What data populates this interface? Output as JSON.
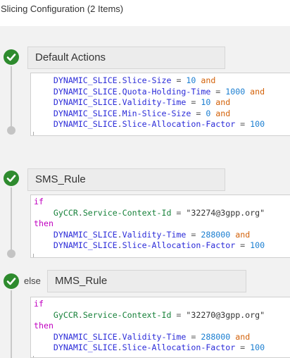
{
  "header": {
    "title": "Slicing Configuration (2 Items)"
  },
  "rules": [
    {
      "name": "Default Actions",
      "prefix": "",
      "lines": [
        [
          {
            "t": "    DYNAMIC_SLICE",
            "c": "obj"
          },
          {
            "t": ".",
            "c": "op"
          },
          {
            "t": "Slice-Size",
            "c": "prop"
          },
          {
            "t": " = ",
            "c": "op"
          },
          {
            "t": "10",
            "c": "num"
          },
          {
            "t": " and",
            "c": "logic"
          }
        ],
        [
          {
            "t": "    DYNAMIC_SLICE",
            "c": "obj"
          },
          {
            "t": ".",
            "c": "op"
          },
          {
            "t": "Quota-Holding-Time",
            "c": "prop"
          },
          {
            "t": " = ",
            "c": "op"
          },
          {
            "t": "1000",
            "c": "num"
          },
          {
            "t": " and",
            "c": "logic"
          }
        ],
        [
          {
            "t": "    DYNAMIC_SLICE",
            "c": "obj"
          },
          {
            "t": ".",
            "c": "op"
          },
          {
            "t": "Validity-Time",
            "c": "prop"
          },
          {
            "t": " = ",
            "c": "op"
          },
          {
            "t": "10",
            "c": "num"
          },
          {
            "t": " and",
            "c": "logic"
          }
        ],
        [
          {
            "t": "    DYNAMIC_SLICE",
            "c": "obj"
          },
          {
            "t": ".",
            "c": "op"
          },
          {
            "t": "Min-Slice-Size",
            "c": "prop"
          },
          {
            "t": " = ",
            "c": "op"
          },
          {
            "t": "0",
            "c": "num"
          },
          {
            "t": " and",
            "c": "logic"
          }
        ],
        [
          {
            "t": "    DYNAMIC_SLICE",
            "c": "obj"
          },
          {
            "t": ".",
            "c": "op"
          },
          {
            "t": "Slice-Allocation-Factor",
            "c": "prop"
          },
          {
            "t": " = ",
            "c": "op"
          },
          {
            "t": "100",
            "c": "num"
          }
        ]
      ]
    },
    {
      "name": "SMS_Rule",
      "prefix": "",
      "lines": [
        [
          {
            "t": "if",
            "c": "kw"
          }
        ],
        [
          {
            "t": "    GyCCR",
            "c": "ctx"
          },
          {
            "t": ".",
            "c": "op"
          },
          {
            "t": "Service-Context-Id",
            "c": "ctx"
          },
          {
            "t": " = ",
            "c": "op"
          },
          {
            "t": "\"32274@3gpp.org\"",
            "c": "str"
          }
        ],
        [
          {
            "t": "then",
            "c": "kw"
          }
        ],
        [
          {
            "t": "    DYNAMIC_SLICE",
            "c": "obj"
          },
          {
            "t": ".",
            "c": "op"
          },
          {
            "t": "Validity-Time",
            "c": "prop"
          },
          {
            "t": " = ",
            "c": "op"
          },
          {
            "t": "288000",
            "c": "num"
          },
          {
            "t": " and",
            "c": "logic"
          }
        ],
        [
          {
            "t": "    DYNAMIC_SLICE",
            "c": "obj"
          },
          {
            "t": ".",
            "c": "op"
          },
          {
            "t": "Slice-Allocation-Factor",
            "c": "prop"
          },
          {
            "t": " = ",
            "c": "op"
          },
          {
            "t": "100",
            "c": "num"
          }
        ]
      ]
    },
    {
      "name": "MMS_Rule",
      "prefix": "else",
      "lines": [
        [
          {
            "t": "if",
            "c": "kw"
          }
        ],
        [
          {
            "t": "    GyCCR",
            "c": "ctx"
          },
          {
            "t": ".",
            "c": "op"
          },
          {
            "t": "Service-Context-Id",
            "c": "ctx"
          },
          {
            "t": " = ",
            "c": "op"
          },
          {
            "t": "\"32270@3gpp.org\"",
            "c": "str"
          }
        ],
        [
          {
            "t": "then",
            "c": "kw"
          }
        ],
        [
          {
            "t": "    DYNAMIC_SLICE",
            "c": "obj"
          },
          {
            "t": ".",
            "c": "op"
          },
          {
            "t": "Validity-Time",
            "c": "prop"
          },
          {
            "t": " = ",
            "c": "op"
          },
          {
            "t": "288000",
            "c": "num"
          },
          {
            "t": " and",
            "c": "logic"
          }
        ],
        [
          {
            "t": "    DYNAMIC_SLICE",
            "c": "obj"
          },
          {
            "t": ".",
            "c": "op"
          },
          {
            "t": "Slice-Allocation-Factor",
            "c": "prop"
          },
          {
            "t": " = ",
            "c": "op"
          },
          {
            "t": "100",
            "c": "num"
          }
        ]
      ]
    }
  ],
  "colors": {
    "check": "#2e8b2e",
    "keyword": "#c000c0",
    "object": "#2b2bd8",
    "number": "#1a7ed1",
    "logic": "#d3620a",
    "context": "#17813a"
  }
}
